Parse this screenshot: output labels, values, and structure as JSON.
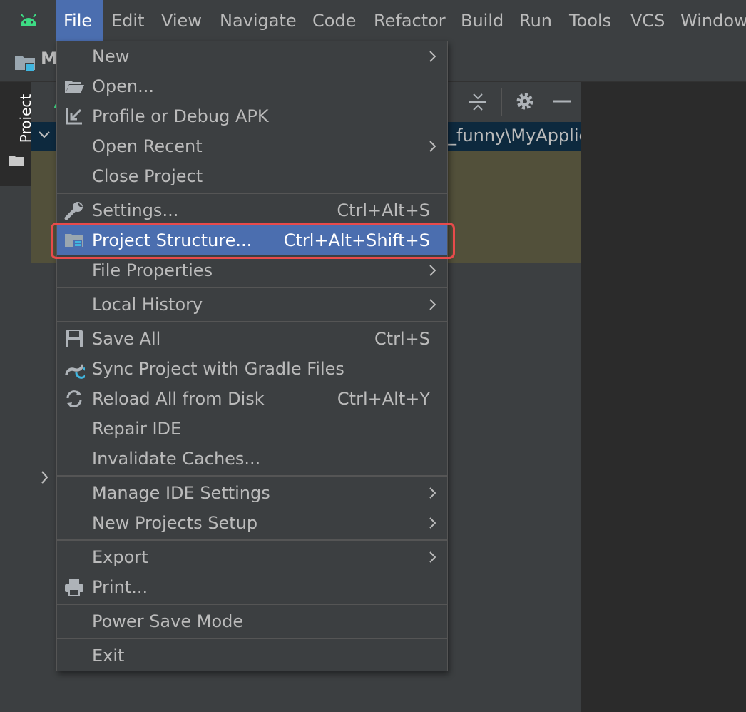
{
  "menubar": {
    "items": [
      {
        "label": "File"
      },
      {
        "label": "Edit"
      },
      {
        "label": "View"
      },
      {
        "label": "Navigate"
      },
      {
        "label": "Code"
      },
      {
        "label": "Refactor"
      },
      {
        "label": "Build"
      },
      {
        "label": "Run"
      },
      {
        "label": "Tools"
      },
      {
        "label": "VCS"
      },
      {
        "label": "Window"
      }
    ]
  },
  "navbar": {
    "title": "M"
  },
  "left_strip": {
    "tab_label": "Project"
  },
  "project_panel": {
    "path_fragment": "_funny\\MyApplic"
  },
  "file_menu": {
    "items": [
      {
        "label": "New",
        "shortcut": ""
      },
      {
        "label": "Open...",
        "shortcut": ""
      },
      {
        "label": "Profile or Debug APK",
        "shortcut": ""
      },
      {
        "label": "Open Recent",
        "shortcut": ""
      },
      {
        "label": "Close Project",
        "shortcut": ""
      },
      {
        "label": "Settings...",
        "shortcut": "Ctrl+Alt+S"
      },
      {
        "label": "Project Structure...",
        "shortcut": "Ctrl+Alt+Shift+S"
      },
      {
        "label": "File Properties",
        "shortcut": ""
      },
      {
        "label": "Local History",
        "shortcut": ""
      },
      {
        "label": "Save All",
        "shortcut": "Ctrl+S"
      },
      {
        "label": "Sync Project with Gradle Files",
        "shortcut": ""
      },
      {
        "label": "Reload All from Disk",
        "shortcut": "Ctrl+Alt+Y"
      },
      {
        "label": "Repair IDE",
        "shortcut": ""
      },
      {
        "label": "Invalidate Caches...",
        "shortcut": ""
      },
      {
        "label": "Manage IDE Settings",
        "shortcut": ""
      },
      {
        "label": "New Projects Setup",
        "shortcut": ""
      },
      {
        "label": "Export",
        "shortcut": ""
      },
      {
        "label": "Print...",
        "shortcut": ""
      },
      {
        "label": "Power Save Mode",
        "shortcut": ""
      },
      {
        "label": "Exit",
        "shortcut": ""
      }
    ]
  },
  "colors": {
    "background": "#3c3f41",
    "selection": "#4b6eaf",
    "highlight_box": "#e84b4b",
    "tree_highlight": "#52503a",
    "editor": "#2b2b2b"
  },
  "icons": [
    "android-logo-icon",
    "project-folder-icon",
    "folder-open-icon",
    "debug-apk-icon",
    "wrench-icon",
    "project-structure-icon",
    "save-icon",
    "gradle-sync-icon",
    "reload-icon",
    "printer-icon",
    "gear-icon",
    "collapse-icon",
    "minimize-icon",
    "submenu-arrow-icon",
    "chevron-icon"
  ]
}
